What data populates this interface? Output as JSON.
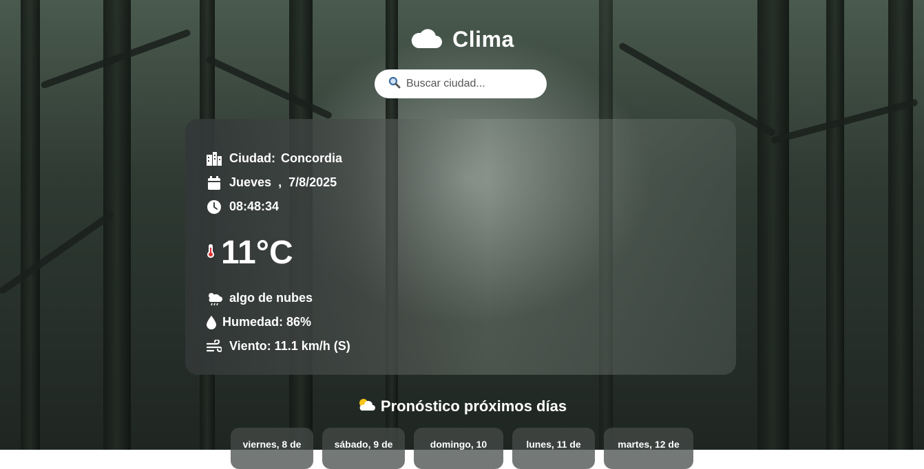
{
  "header": {
    "title": "Clima",
    "icon": "cloud-icon"
  },
  "search": {
    "placeholder": "Buscar ciudad...",
    "icon": "search-icon"
  },
  "current": {
    "city_label": "Ciudad:",
    "city": "Concordia",
    "day": "Jueves",
    "separator": ",",
    "date": "7/8/2025",
    "time": "08:48:34",
    "temperature": "11°C",
    "description": "algo de nubes",
    "humidity": "Humedad: 86%",
    "wind": "Viento: 11.1 km/h (S)"
  },
  "forecast": {
    "title": "Pronóstico próximos días",
    "days": [
      {
        "label": "viernes, 8 de"
      },
      {
        "label": "sábado, 9 de"
      },
      {
        "label": "domingo, 10"
      },
      {
        "label": "lunes, 11 de"
      },
      {
        "label": "martes, 12 de"
      }
    ]
  },
  "colors": {
    "accent": "#ffffff",
    "card": "#3c4240"
  }
}
